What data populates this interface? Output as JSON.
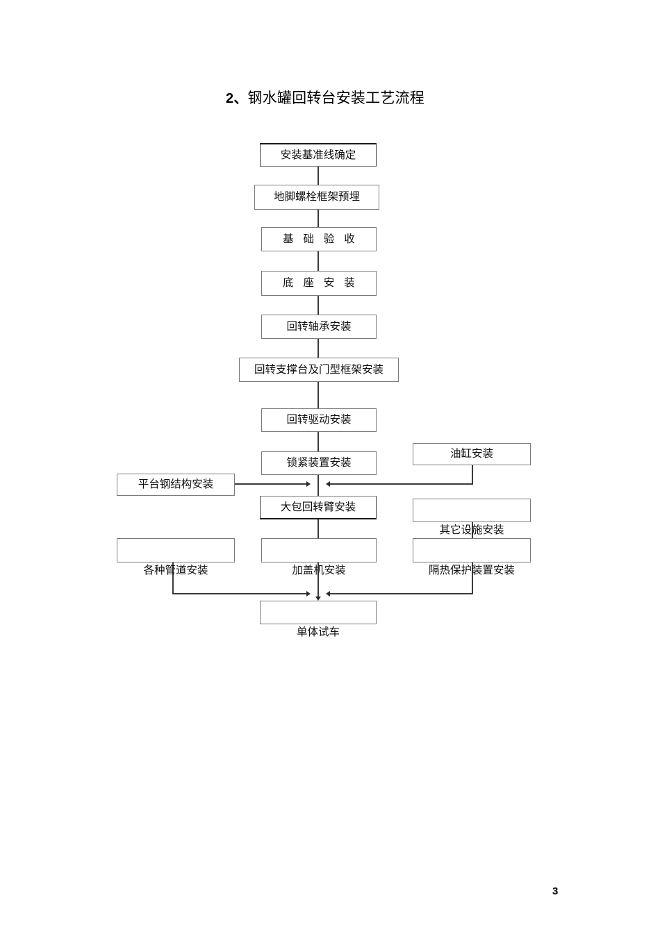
{
  "document": {
    "title_number": "2、",
    "title_text": "钢水罐回转台安装工艺流程",
    "page_number": "3"
  },
  "flowchart": {
    "type": "process-flow-diagram",
    "orientation": "top-to-bottom",
    "nodes": [
      {
        "id": "n1",
        "label": "安装基准线确定",
        "column": "center"
      },
      {
        "id": "n2",
        "label": "地脚螺栓框架预埋",
        "column": "center"
      },
      {
        "id": "n3",
        "label": "基 础 验 收",
        "column": "center"
      },
      {
        "id": "n4",
        "label": "底 座 安 装",
        "column": "center"
      },
      {
        "id": "n5",
        "label": "回转轴承安装",
        "column": "center"
      },
      {
        "id": "n6",
        "label": "回转支撑台及门型框架安装",
        "column": "center"
      },
      {
        "id": "n7",
        "label": "回转驱动安装",
        "column": "center"
      },
      {
        "id": "n8",
        "label": "锁紧装置安装",
        "column": "center"
      },
      {
        "id": "n9",
        "label": "平台钢结构安装",
        "column": "left"
      },
      {
        "id": "n10",
        "label": "油缸安装",
        "column": "right"
      },
      {
        "id": "n11",
        "label": "大包回转臂安装",
        "column": "center"
      },
      {
        "id": "n12",
        "label": "其它设施安装",
        "column": "right"
      },
      {
        "id": "n13",
        "label": "各种管道安装",
        "column": "left"
      },
      {
        "id": "n14",
        "label": "加盖机安装",
        "column": "center"
      },
      {
        "id": "n15",
        "label": "隔热保护装置安装",
        "column": "right"
      },
      {
        "id": "n16",
        "label": "单体试车",
        "column": "center"
      }
    ],
    "edges": [
      {
        "from": "n1",
        "to": "n2"
      },
      {
        "from": "n2",
        "to": "n3"
      },
      {
        "from": "n3",
        "to": "n4"
      },
      {
        "from": "n4",
        "to": "n5"
      },
      {
        "from": "n5",
        "to": "n6"
      },
      {
        "from": "n6",
        "to": "n7"
      },
      {
        "from": "n7",
        "to": "n8"
      },
      {
        "from": "n8",
        "to": "n11"
      },
      {
        "from": "n9",
        "to": "n11"
      },
      {
        "from": "n10",
        "to": "n11"
      },
      {
        "from": "n11",
        "to": "n14"
      },
      {
        "from": "n12",
        "to": "n15"
      },
      {
        "from": "n13",
        "to": "n16"
      },
      {
        "from": "n14",
        "to": "n16"
      },
      {
        "from": "n15",
        "to": "n16"
      }
    ],
    "colors": {
      "box_border": "#7a7a7a",
      "emphasis_border": "#1a1a1a",
      "connector": "#3a3a3a",
      "text": "#111111",
      "background": "#ffffff"
    }
  }
}
